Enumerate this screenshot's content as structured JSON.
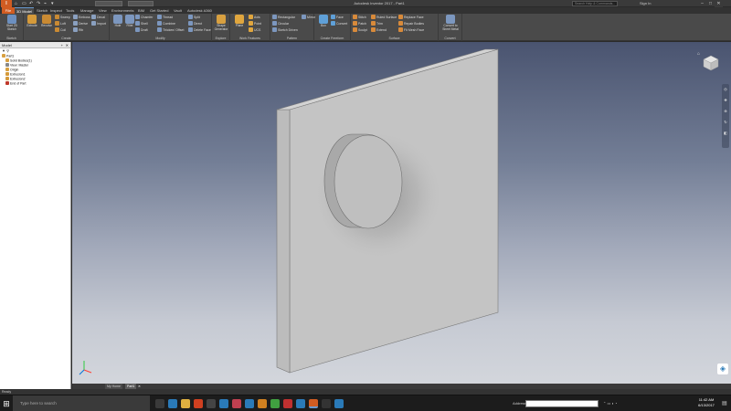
{
  "app": {
    "title": "Autodesk Inventor 2017 - Part1",
    "logo_label": "I",
    "search_placeholder": "Search Help & Commands...",
    "signin": "Sign In",
    "quickaccess": [
      "⌂",
      "▭",
      "↶",
      "↷",
      "⌁",
      "▾"
    ]
  },
  "tabs": [
    "File",
    "3D Model",
    "Sketch",
    "Inspect",
    "Tools",
    "Manage",
    "View",
    "Environments",
    "BIM",
    "Get Started",
    "Vault",
    "Autodesk A360"
  ],
  "ribbon": {
    "sketch": {
      "label": "Sketch",
      "start": "Start 2D Sketch"
    },
    "create": {
      "label": "Create",
      "extrude": "Extrude",
      "revolve": "Revolve",
      "sweep": "Sweep",
      "loft": "Loft",
      "coil": "Coil",
      "emboss": "Emboss",
      "derive": "Derive",
      "rib": "Rib",
      "decal": "Decal",
      "import": "Import"
    },
    "modify": {
      "label": "Modify",
      "hole": "Hole",
      "fillet": "Fillet",
      "chamfer": "Chamfer",
      "shell": "Shell",
      "draft": "Draft",
      "thread": "Thread",
      "combine": "Combine",
      "thicken": "Thicken/ Offset",
      "split": "Split",
      "direct": "Direct",
      "delete_face": "Delete Face"
    },
    "explore": {
      "label": "Explore",
      "shape": "Shape Generator"
    },
    "work": {
      "label": "Work Features",
      "plane": "Plane",
      "axis": "Axis",
      "point": "Point",
      "ucs": "UCS"
    },
    "pattern": {
      "label": "Pattern",
      "rectangular": "Rectangular",
      "circular": "Circular",
      "sketch_driven": "Sketch Driven",
      "mirror": "Mirror"
    },
    "freeform": {
      "label": "Create Freeform",
      "box": "Box",
      "face": "Face",
      "convert": "Convert"
    },
    "surface": {
      "label": "Surface",
      "stitch": "Stitch",
      "patch": "Patch",
      "sculpt": "Sculpt",
      "ruled": "Ruled Surface",
      "trim": "Trim",
      "extend": "Extend",
      "replace": "Replace Face",
      "repair": "Repair Bodies",
      "fit_mesh": "Fit Mesh Face"
    },
    "convert": {
      "label": "Convert",
      "sheet_metal": "Convert to Sheet Metal"
    }
  },
  "browser": {
    "header": "Model",
    "tree": [
      "Part1",
      "Solid Bodies(1)",
      "View: Master",
      "Origin",
      "Extrusion1",
      "Extrusion2",
      "End of Part"
    ]
  },
  "doc_tabs": [
    "My Home",
    "Part1"
  ],
  "status": "Ready",
  "taskbar": {
    "cortana": "Type here to search",
    "address_label": "Address",
    "time": "11:42 AM",
    "date": "6/13/2017"
  },
  "colors": {
    "ribbon_bg": "#4a4a4a",
    "accent": "#d15c22",
    "model_face": "#c4c4c4",
    "model_side": "#bdbdbd",
    "model_top": "#d2d2d2"
  }
}
